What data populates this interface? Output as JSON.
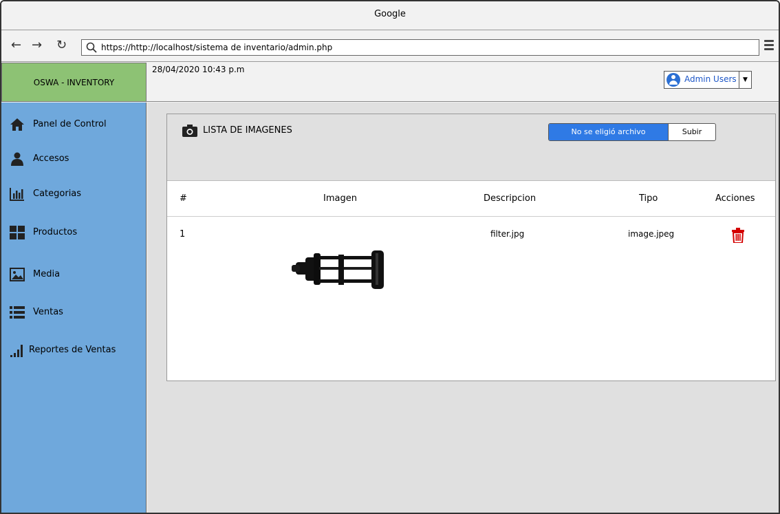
{
  "browser": {
    "title": "Google",
    "url": "https://http://localhost/sistema de inventario/admin.php"
  },
  "app": {
    "brand": "OSWA - INVENTORY",
    "datetime": "28/04/2020 10:43 p.m",
    "user_label": "Admin Users"
  },
  "sidebar": {
    "items": [
      {
        "label": "Panel de Control",
        "icon": "home-icon"
      },
      {
        "label": "Accesos",
        "icon": "user-icon"
      },
      {
        "label": "Categorias",
        "icon": "bar-chart-icon"
      },
      {
        "label": "Productos",
        "icon": "grid-icon"
      },
      {
        "label": "Media",
        "icon": "image-icon"
      },
      {
        "label": "Ventas",
        "icon": "list-icon"
      },
      {
        "label": "Reportes de Ventas",
        "icon": "signal-bars-icon"
      }
    ]
  },
  "panel": {
    "title": "LISTA DE IMAGENES",
    "file_label": "No se eligió archivo",
    "upload_label": "Subir"
  },
  "table": {
    "headers": [
      "#",
      "Imagen",
      "Descripcion",
      "Tipo",
      "Acciones"
    ],
    "rows": [
      {
        "num": "1",
        "descripcion": "filter.jpg",
        "tipo": "image.jpeg"
      }
    ]
  },
  "colors": {
    "brand_bg": "#8dc274",
    "sidebar_bg": "#6fa8dc",
    "file_button": "#2f7ae5",
    "trash": "#d40000"
  }
}
